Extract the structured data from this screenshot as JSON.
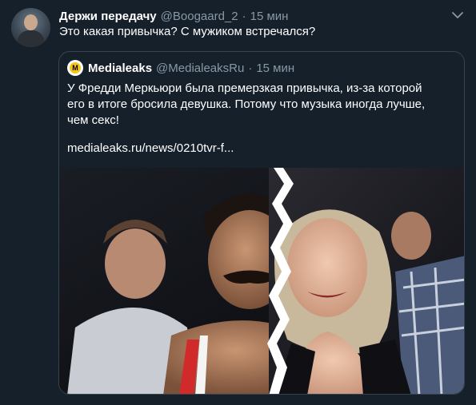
{
  "tweet": {
    "author_name": "Держи передачу",
    "author_handle": "@Boogaard_2",
    "separator": "·",
    "time": "15 мин",
    "text": "Это какая привычка? С мужиком встречался?"
  },
  "quoted_tweet": {
    "avatar_letter": "M",
    "author_name": "Medialeaks",
    "author_handle": "@MedialeaksRu",
    "separator": "·",
    "time": "15 мин",
    "text_lines": [
      "У Фредди Меркьюри была премерзкая привычка, из-за которой",
      "его в итоге бросила девушка. Потому что музыка иногда лучше,",
      "чем секс!"
    ],
    "link": "medialeaks.ru/news/0210tvr-f..."
  },
  "colors": {
    "background": "#15202b",
    "border": "#38444d",
    "secondary_text": "#8899a6",
    "primary_text": "#ffffff"
  },
  "icons": {
    "more": "chevron-down-icon",
    "quoted_avatar": "medialeaks-logo-icon"
  }
}
